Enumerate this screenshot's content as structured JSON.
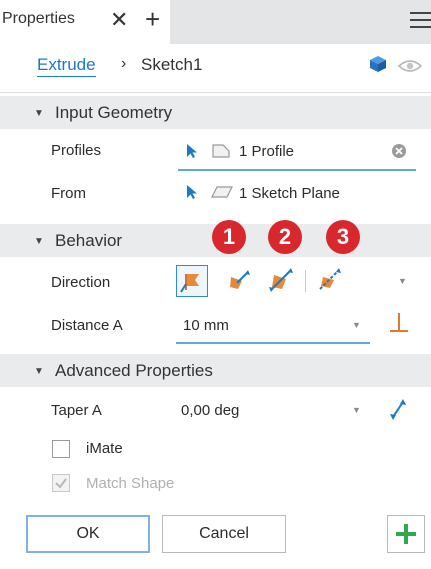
{
  "tabbar": {
    "tab_label": "Properties",
    "close_glyph": "✕",
    "add_glyph": "+",
    "menu_icon": "hamburger-menu-icon"
  },
  "breadcrumb": {
    "feature": "Extrude",
    "separator": "›",
    "sketch": "Sketch1",
    "icons": [
      "cube-icon",
      "eye-icon"
    ]
  },
  "sections": {
    "input_geometry": "Input Geometry",
    "behavior": "Behavior",
    "advanced": "Advanced Properties"
  },
  "input_geometry": {
    "profiles_label": "Profiles",
    "profiles_value": "1 Profile",
    "from_label": "From",
    "from_value": "1 Sketch Plane"
  },
  "behavior": {
    "direction_label": "Direction",
    "distance_label": "Distance A",
    "distance_value": "10 mm",
    "callouts": [
      "1",
      "2",
      "3"
    ],
    "direction_options": [
      "default-direction-icon",
      "flipped-direction-icon",
      "symmetric-direction-icon",
      "asymmetric-direction-icon"
    ]
  },
  "advanced": {
    "taper_label": "Taper A",
    "taper_value": "0,00 deg",
    "imate_label": "iMate",
    "imate_checked": false,
    "match_shape_label": "Match Shape",
    "match_shape_checked": true
  },
  "footer": {
    "ok_label": "OK",
    "cancel_label": "Cancel",
    "apply_glyph": "+"
  },
  "colors": {
    "accent": "#1a7ac9",
    "callout": "#d9272e",
    "section_bg": "#eaebec",
    "apply_green": "#2fa84f"
  }
}
